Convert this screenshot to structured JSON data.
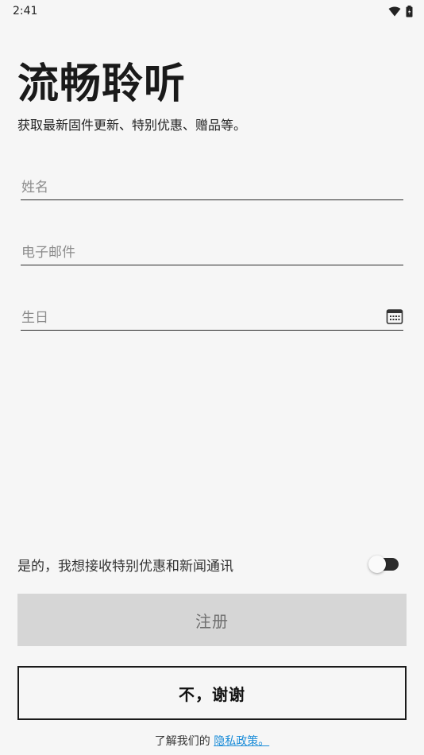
{
  "status_bar": {
    "time": "2:41",
    "icons": [
      "wifi-icon",
      "battery-icon"
    ]
  },
  "header": {
    "title": "流畅聆听",
    "subtitle": "获取最新固件更新、特别优惠、赠品等。"
  },
  "form": {
    "name": {
      "placeholder": "姓名",
      "value": ""
    },
    "email": {
      "placeholder": "电子邮件",
      "value": ""
    },
    "birthday": {
      "placeholder": "生日",
      "value": "",
      "icon": "calendar-icon"
    }
  },
  "optin": {
    "label": "是的，我想接收特别优惠和新闻通讯",
    "toggle_on": false
  },
  "buttons": {
    "register_label": "注册",
    "decline_label": "不，谢谢"
  },
  "footer": {
    "privacy_prefix": "了解我们的",
    "privacy_link": "隐私政策。"
  },
  "colors": {
    "background": "#f6f6f6",
    "register_button_bg": "#d6d6d6",
    "link": "#1a8cd8",
    "toggle_track": "#2b2b2b"
  }
}
